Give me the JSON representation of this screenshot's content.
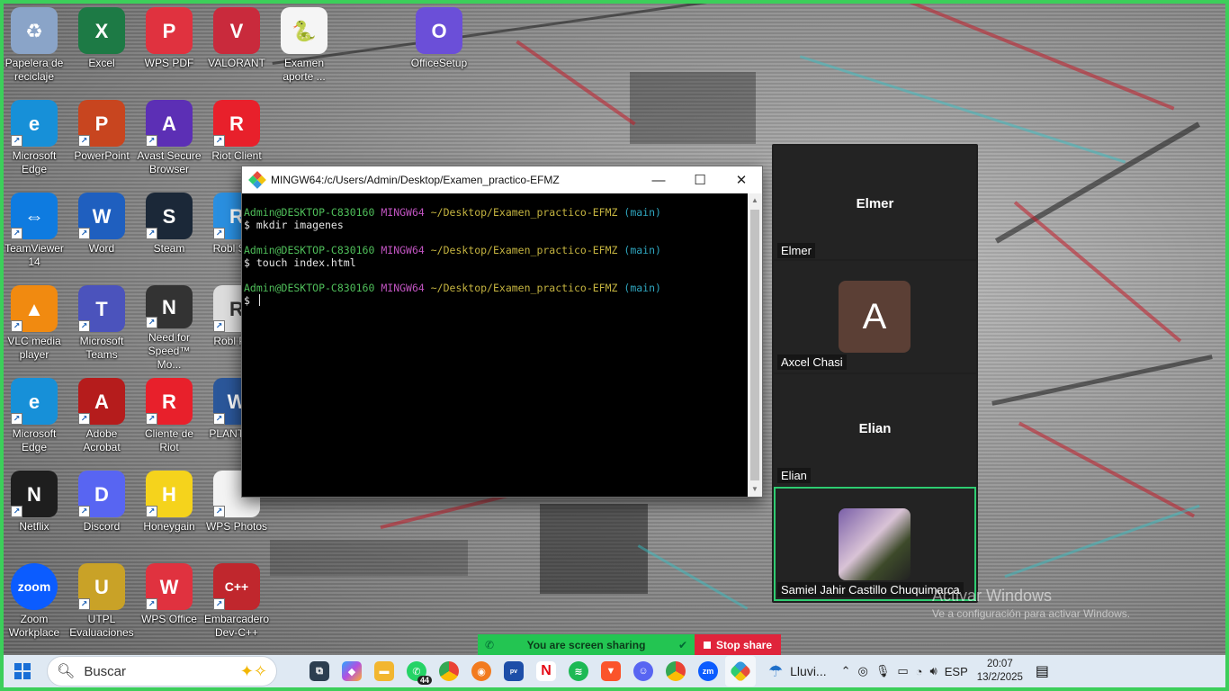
{
  "desktop_icons": [
    {
      "label": "Papelera de reciclaje",
      "color": "#8aa4c8",
      "glyph": "♻"
    },
    {
      "label": "Excel",
      "color": "#1d7a45",
      "glyph": "X"
    },
    {
      "label": "WPS PDF",
      "color": "#e0323f",
      "glyph": "P"
    },
    {
      "label": "VALORANT",
      "color": "#c92a3c",
      "glyph": "V"
    },
    {
      "label": "Examen aporte ...",
      "color": "#f5f5f5",
      "glyph": "🐍"
    },
    {
      "label": "OfficeSetup",
      "color": "#6b4fd8",
      "glyph": "O"
    },
    {
      "label": "Microsoft Edge",
      "color": "#1790d8",
      "glyph": "e"
    },
    {
      "label": "PowerPoint",
      "color": "#c8451f",
      "glyph": "P"
    },
    {
      "label": "Avast Secure Browser",
      "color": "#5c2fb5",
      "glyph": "A"
    },
    {
      "label": "Riot Client",
      "color": "#e8202b",
      "glyph": "R"
    },
    {
      "label": "TeamViewer 14",
      "color": "#0e7be0",
      "glyph": "⇔"
    },
    {
      "label": "Word",
      "color": "#1f5fbf",
      "glyph": "W"
    },
    {
      "label": "Steam",
      "color": "#1b2838",
      "glyph": "S"
    },
    {
      "label": "Robl Stud",
      "color": "#2a8fe0",
      "glyph": "R"
    },
    {
      "label": "VLC media player",
      "color": "#f18a10",
      "glyph": "▲"
    },
    {
      "label": "Microsoft Teams",
      "color": "#4b53bc",
      "glyph": "T"
    },
    {
      "label": "Need for Speed™ Mo...",
      "color": "#333333",
      "glyph": "N"
    },
    {
      "label": "Robl Play",
      "color": "#dddddd",
      "glyph": "R"
    },
    {
      "label": "Microsoft Edge",
      "color": "#1790d8",
      "glyph": "e"
    },
    {
      "label": "Adobe Acrobat",
      "color": "#b51c1c",
      "glyph": "A"
    },
    {
      "label": "Cliente de Riot",
      "color": "#e8202b",
      "glyph": "R"
    },
    {
      "label": "PLANT IEE",
      "color": "#2b579a",
      "glyph": "W"
    },
    {
      "label": "Netflix",
      "color": "#1e1e1e",
      "glyph": "N"
    },
    {
      "label": "Discord",
      "color": "#5865f2",
      "glyph": "D"
    },
    {
      "label": "Honeygain",
      "color": "#f5d31c",
      "glyph": "H"
    },
    {
      "label": "WPS Photos",
      "color": "#f4f4f4",
      "glyph": " "
    },
    {
      "label": "Zoom Workplace",
      "color": "#0b5cff",
      "glyph": "zoom"
    },
    {
      "label": "UTPL Evaluaciones",
      "color": "#c9a227",
      "glyph": "U"
    },
    {
      "label": "WPS Office",
      "color": "#e0323f",
      "glyph": "W"
    },
    {
      "label": "Embarcadero Dev-C++",
      "color": "#c0272d",
      "glyph": "C++"
    }
  ],
  "terminal": {
    "title": "MINGW64:/c/Users/Admin/Desktop/Examen_practico-EFMZ",
    "minimize": "—",
    "maximize": "☐",
    "close": "✕",
    "prompt_user": "Admin@DESKTOP-C830160",
    "prompt_sys": "MINGW64",
    "prompt_path": "~/Desktop/Examen_practico-EFMZ",
    "prompt_branch": "(main)",
    "commands": [
      "$ mkdir imagenes",
      "$ touch index.html",
      "$ "
    ],
    "scroll_up": "▲",
    "scroll_down": "▼"
  },
  "participants": {
    "elmer_big": "Elmer",
    "elmer_tag": "Elmer",
    "axcel_initial": "A",
    "axcel_tag": "Axcel Chasi",
    "elian_big": "Elian",
    "elian_tag": "Elian",
    "samiel_tag": "Samiel Jahir Castillo Chuquimarca",
    "active_color": "#2ecc71"
  },
  "share_bar": {
    "sharing_text": "You are screen sharing",
    "stop_text": "Stop share"
  },
  "watermark": {
    "line1": "Activar Windows",
    "line2": "Ve a configuración para activar Windows."
  },
  "taskbar": {
    "search_placeholder": "Buscar",
    "whatsapp_badge": "44",
    "weather_text": "Lluvi...",
    "lang": "ESP",
    "time": "20:07",
    "date": "13/2/2025"
  }
}
